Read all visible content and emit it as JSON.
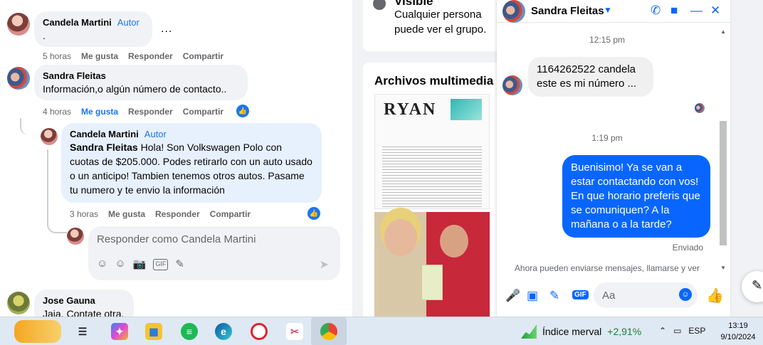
{
  "feed": {
    "comment1": {
      "author": "Candela Martini",
      "tag": "Autor",
      "text": ".",
      "time": "5 horas",
      "like": "Me gusta",
      "reply": "Responder",
      "share": "Compartir",
      "more": "..."
    },
    "comment2": {
      "author": "Sandra Fleitas",
      "text": "Información,o algún número de contacto..",
      "time": "4 horas",
      "like": "Me gusta",
      "reply": "Responder",
      "share": "Compartir"
    },
    "comment3": {
      "author": "Candela Martini",
      "tag": "Autor",
      "mention": "Sandra Fleitas",
      "text": " Hola! Son Volkswagen Polo con cuotas de $205.000. Podes retirarlo con un auto usado o un anticipo! Tambien tenemos otros autos. Pasame tu numero y te envio la información",
      "time": "3 horas",
      "like": "Me gusta",
      "reply": "Responder",
      "share": "Compartir"
    },
    "reply_box": {
      "placeholder": "Responder como Candela Martini"
    },
    "comment4": {
      "author": "Jose Gauna",
      "text": "Jaja. Contate otra."
    }
  },
  "middle": {
    "visible_title": "Visible",
    "visible_desc": "Cualquier persona puede ver el grupo.",
    "media_title": "Archivos multimedia recientes",
    "media1_brand": "RYAN"
  },
  "chat": {
    "name": "Sandra Fleitas",
    "ts1": "12:15 pm",
    "incoming": "1164262522  candela este es mi número ...",
    "ts2": "1:19 pm",
    "outgoing": "Buenisimo! Ya se van a estar contactando con vos! En que horario preferis que se comuniquen? A la mañana o a la tarde?",
    "sent_label": "Enviado",
    "notice": "Ahora pueden enviarse mensajes, llamarse y ver",
    "composer_placeholder": "Aa"
  },
  "taskbar": {
    "widget_label": "Índice merval",
    "widget_delta": "+2,91%",
    "lang": "ESP",
    "time": "13:19",
    "date": "9/10/2024"
  },
  "colors": {
    "accent": "#0866ff",
    "fb_blue": "#1877f2",
    "reply_bg": "#e7f0fd",
    "taskbar": "#dfe9f3"
  }
}
